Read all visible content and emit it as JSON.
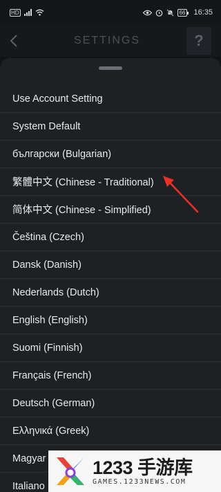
{
  "status_bar": {
    "left_icons": [
      "hd-icon",
      "signal-icon",
      "wifi-icon"
    ],
    "right_icons": [
      "eye-icon",
      "alarm-icon",
      "mute-icon",
      "battery-icon"
    ],
    "battery_level": "66",
    "time": "16:35"
  },
  "app_bar": {
    "title": "SETTINGS",
    "back_icon": "chevron-left-icon",
    "help_label": "?"
  },
  "language_list": {
    "items": [
      {
        "label": "Use Account Setting"
      },
      {
        "label": "System Default"
      },
      {
        "label": "български (Bulgarian)"
      },
      {
        "label": "繁體中文 (Chinese - Traditional)"
      },
      {
        "label": "简体中文 (Chinese - Simplified)"
      },
      {
        "label": "Čeština (Czech)"
      },
      {
        "label": "Dansk (Danish)"
      },
      {
        "label": "Nederlands (Dutch)"
      },
      {
        "label": "English (English)"
      },
      {
        "label": "Suomi (Finnish)"
      },
      {
        "label": "Français (French)"
      },
      {
        "label": "Deutsch (German)"
      },
      {
        "label": "Ελληνικά (Greek)"
      },
      {
        "label": "Magyar"
      },
      {
        "label": "Italiano"
      }
    ]
  },
  "annotation": {
    "icon": "red-arrow-icon",
    "color": "#e8302a"
  },
  "watermark": {
    "main": "1233 手游库",
    "sub": "GAMES.1233NEWS.COM"
  },
  "colors": {
    "background": "#101214",
    "sheet": "#1e2124",
    "divider": "#2c3034",
    "text": "#e8eaec"
  }
}
